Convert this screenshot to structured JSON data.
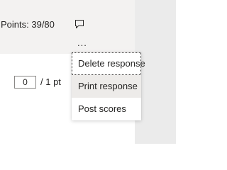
{
  "header": {
    "points_text": "Points: 39/80"
  },
  "icons": {
    "comment": "comment-icon",
    "more": "more-options-icon",
    "more_glyph": "..."
  },
  "score": {
    "value": "0",
    "max_text": "/ 1 pt"
  },
  "menu": {
    "items": [
      {
        "label": "Delete response"
      },
      {
        "label": "Print response"
      },
      {
        "label": "Post scores"
      }
    ]
  },
  "colors": {
    "header_background": "#f3f2f1",
    "side_panel_background": "#ebebeb",
    "hover_background": "#edebe9",
    "text": "#252423"
  }
}
